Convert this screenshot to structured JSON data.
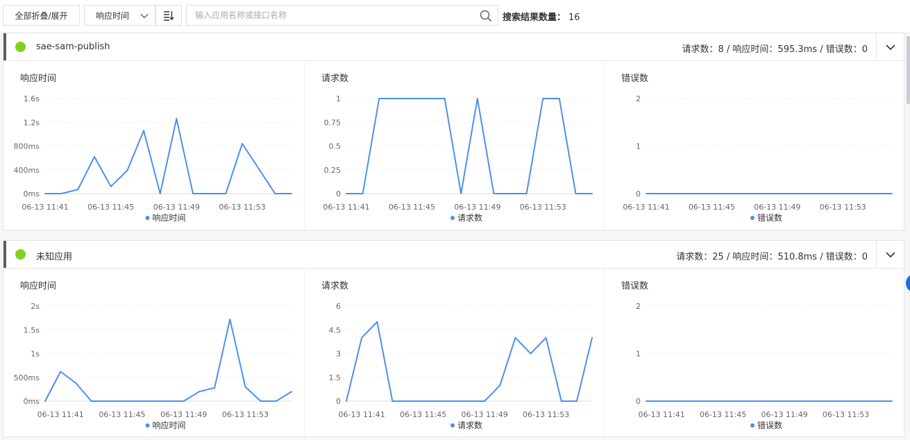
{
  "toolbar": {
    "collapse_label": "全部折叠/展开",
    "sort_select": "响应时间",
    "search_placeholder": "输入应用名称或接口名称",
    "result_label": "搜索结果数量：",
    "result_count": "16"
  },
  "colors": {
    "line": "#4a8ff0",
    "status_dot": "#7ed321",
    "accent": "#1e6fd9"
  },
  "cards": [
    {
      "name": "sae-sam-publish",
      "stats": "请求数：8 / 响应时间：595.3ms / 错误数：0",
      "panels": [
        {
          "title": "响应时间",
          "chart_data": {
            "type": "line",
            "x": [
              "06-13 11:41",
              "06-13 11:42",
              "06-13 11:43",
              "06-13 11:44",
              "06-13 11:45",
              "06-13 11:46",
              "06-13 11:47",
              "06-13 11:48",
              "06-13 11:49",
              "06-13 11:50",
              "06-13 11:51",
              "06-13 11:52",
              "06-13 11:53",
              "06-13 11:54",
              "06-13 11:55",
              "06-13 11:56"
            ],
            "x_ticks": [
              "06-13 11:41",
              "06-13 11:45",
              "06-13 11:49",
              "06-13 11:53"
            ],
            "y_ticks": [
              "0ms",
              "400ms",
              "800ms",
              "1.2s",
              "1.6s"
            ],
            "ylim": [
              0,
              1.6
            ],
            "series": [
              {
                "name": "响应时间",
                "values": [
                  0,
                  0,
                  0.07,
                  0.62,
                  0.12,
                  0.39,
                  1.06,
                  0,
                  1.26,
                  0,
                  0,
                  0,
                  0.84,
                  0.42,
                  0,
                  0
                ]
              }
            ]
          }
        },
        {
          "title": "请求数",
          "chart_data": {
            "type": "line",
            "x": [
              "06-13 11:41",
              "06-13 11:42",
              "06-13 11:43",
              "06-13 11:44",
              "06-13 11:45",
              "06-13 11:46",
              "06-13 11:47",
              "06-13 11:48",
              "06-13 11:49",
              "06-13 11:50",
              "06-13 11:51",
              "06-13 11:52",
              "06-13 11:53",
              "06-13 11:54",
              "06-13 11:55",
              "06-13 11:56"
            ],
            "x_ticks": [
              "06-13 11:41",
              "06-13 11:45",
              "06-13 11:49",
              "06-13 11:53"
            ],
            "y_ticks": [
              "0",
              "0.25",
              "0.5",
              "0.75",
              "1"
            ],
            "ylim": [
              0,
              1
            ],
            "series": [
              {
                "name": "请求数",
                "values": [
                  0,
                  0,
                  1,
                  1,
                  1,
                  1,
                  1,
                  0,
                  1,
                  0,
                  0,
                  0,
                  1,
                  1,
                  0,
                  0
                ]
              }
            ]
          }
        },
        {
          "title": "错误数",
          "chart_data": {
            "type": "line",
            "x": [
              "06-13 11:41",
              "06-13 11:42",
              "06-13 11:43",
              "06-13 11:44",
              "06-13 11:45",
              "06-13 11:46",
              "06-13 11:47",
              "06-13 11:48",
              "06-13 11:49",
              "06-13 11:50",
              "06-13 11:51",
              "06-13 11:52",
              "06-13 11:53",
              "06-13 11:54",
              "06-13 11:55",
              "06-13 11:56"
            ],
            "x_ticks": [
              "06-13 11:41",
              "06-13 11:45",
              "06-13 11:49",
              "06-13 11:53"
            ],
            "y_ticks": [
              "0",
              "1",
              "2"
            ],
            "ylim": [
              0,
              2
            ],
            "series": [
              {
                "name": "错误数",
                "values": [
                  0,
                  0,
                  0,
                  0,
                  0,
                  0,
                  0,
                  0,
                  0,
                  0,
                  0,
                  0,
                  0,
                  0,
                  0,
                  0
                ]
              }
            ]
          }
        }
      ]
    },
    {
      "name": "未知应用",
      "stats": "请求数：25 / 响应时间：510.8ms / 错误数：0",
      "panels": [
        {
          "title": "响应时间",
          "chart_data": {
            "type": "line",
            "x": [
              "06-13 11:40",
              "06-13 11:41",
              "06-13 11:42",
              "06-13 11:43",
              "06-13 11:44",
              "06-13 11:45",
              "06-13 11:46",
              "06-13 11:47",
              "06-13 11:48",
              "06-13 11:49",
              "06-13 11:50",
              "06-13 11:51",
              "06-13 11:52",
              "06-13 11:53",
              "06-13 11:54",
              "06-13 11:55",
              "06-13 11:56"
            ],
            "x_ticks": [
              "06-13 11:41",
              "06-13 11:45",
              "06-13 11:49",
              "06-13 11:53"
            ],
            "y_ticks": [
              "0ms",
              "500ms",
              "1s",
              "1.5s",
              "2s"
            ],
            "ylim": [
              0,
              2
            ],
            "series": [
              {
                "name": "响应时间",
                "values": [
                  0,
                  0.62,
                  0.38,
                  0,
                  0,
                  0,
                  0,
                  0,
                  0,
                  0,
                  0.2,
                  0.28,
                  1.72,
                  0.3,
                  0,
                  0,
                  0.2
                ]
              }
            ]
          }
        },
        {
          "title": "请求数",
          "chart_data": {
            "type": "line",
            "x": [
              "06-13 11:40",
              "06-13 11:41",
              "06-13 11:42",
              "06-13 11:43",
              "06-13 11:44",
              "06-13 11:45",
              "06-13 11:46",
              "06-13 11:47",
              "06-13 11:48",
              "06-13 11:49",
              "06-13 11:50",
              "06-13 11:51",
              "06-13 11:52",
              "06-13 11:53",
              "06-13 11:54",
              "06-13 11:55",
              "06-13 11:56"
            ],
            "x_ticks": [
              "06-13 11:41",
              "06-13 11:45",
              "06-13 11:49",
              "06-13 11:53"
            ],
            "y_ticks": [
              "0",
              "1.5",
              "3",
              "4.5",
              "6"
            ],
            "ylim": [
              0,
              6
            ],
            "series": [
              {
                "name": "请求数",
                "values": [
                  0,
                  4,
                  5,
                  0,
                  0,
                  0,
                  0,
                  0,
                  0,
                  0,
                  1,
                  4,
                  3,
                  4,
                  0,
                  0,
                  4
                ]
              }
            ]
          }
        },
        {
          "title": "错误数",
          "chart_data": {
            "type": "line",
            "x": [
              "06-13 11:40",
              "06-13 11:41",
              "06-13 11:42",
              "06-13 11:43",
              "06-13 11:44",
              "06-13 11:45",
              "06-13 11:46",
              "06-13 11:47",
              "06-13 11:48",
              "06-13 11:49",
              "06-13 11:50",
              "06-13 11:51",
              "06-13 11:52",
              "06-13 11:53",
              "06-13 11:54",
              "06-13 11:55",
              "06-13 11:56"
            ],
            "x_ticks": [
              "06-13 11:41",
              "06-13 11:45",
              "06-13 11:49",
              "06-13 11:53"
            ],
            "y_ticks": [
              "0",
              "1",
              "2"
            ],
            "ylim": [
              0,
              2
            ],
            "series": [
              {
                "name": "错误数",
                "values": [
                  0,
                  0,
                  0,
                  0,
                  0,
                  0,
                  0,
                  0,
                  0,
                  0,
                  0,
                  0,
                  0,
                  0,
                  0,
                  0,
                  0
                ]
              }
            ]
          }
        }
      ]
    }
  ]
}
